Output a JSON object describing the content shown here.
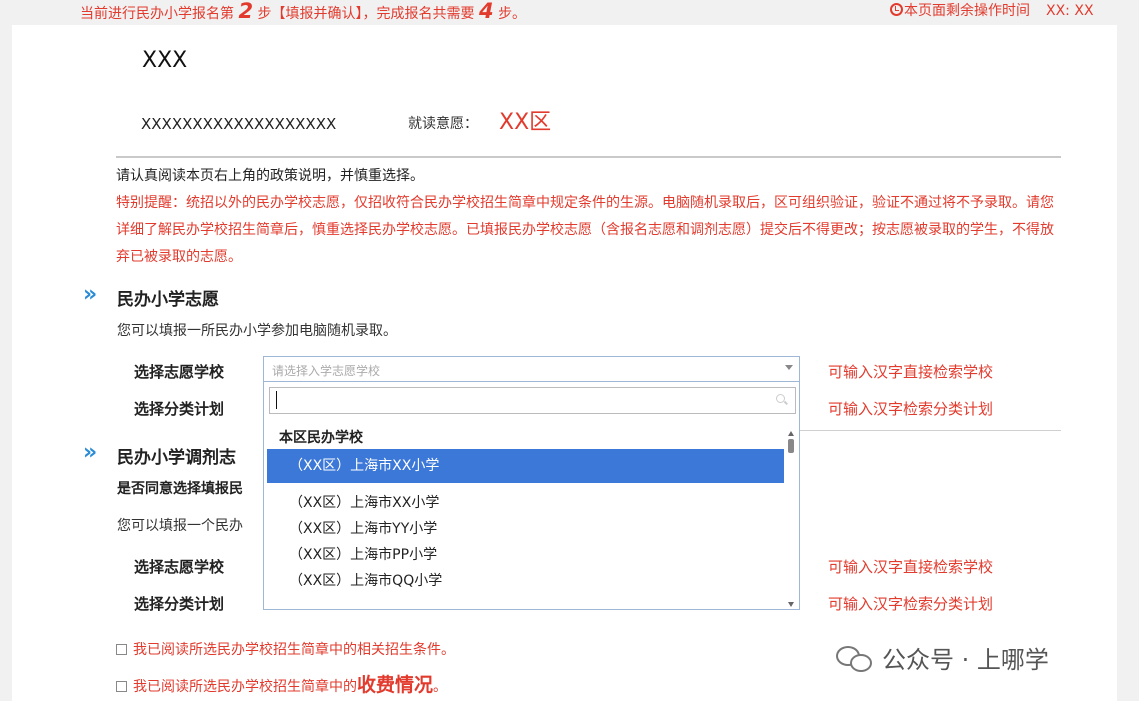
{
  "topbar": {
    "step_prefix": "当前进行民办小学报名第",
    "step_current": "2",
    "step_middle": "步【填报并确认】，完成报名共需要",
    "step_total": "4",
    "step_suffix": "步。",
    "timer_label": "本页面剩余操作时间",
    "timer_value": "XX: XX"
  },
  "student": {
    "name": "XXX",
    "id_number": "XXXXXXXXXXXXXXXXXXX",
    "intent_label": "就读意愿：",
    "intent_value": "XX区"
  },
  "notice": "请认真阅读本页右上角的政策说明，并慎重选择。",
  "warning": "特别提醒：统招以外的民办学校志愿，仅招收符合民办学校招生简章中规定条件的生源。电脑随机录取后，区可组织验证，验证不通过将不予录取。请您详细了解民办学校招生简章后，慎重选择民办学校志愿。已填报民办学校志愿（含报名志愿和调剂志愿）提交后不得更改；按志愿被录取的学生，不得放弃已被录取的志愿。",
  "section1": {
    "title": "民办小学志愿",
    "desc": "您可以填报一所民办小学参加电脑随机录取。",
    "school_label": "选择志愿学校",
    "plan_label": "选择分类计划",
    "school_hint": "可输入汉字直接检索学校",
    "plan_hint": "可输入汉字检索分类计划",
    "school_placeholder": "请选择入学志愿学校"
  },
  "section2": {
    "title": "民办小学调剂志",
    "question": "是否同意选择填报民",
    "desc": "您可以填报一个民办",
    "school_label": "选择志愿学校",
    "plan_label": "选择分类计划",
    "school_hint": "可输入汉字直接检索学校",
    "plan_hint": "可输入汉字检索分类计划"
  },
  "dropdown": {
    "search_value": "",
    "group_label": "本区民办学校",
    "options": [
      "（XX区）上海市XX小学",
      "（XX区）上海市XX小学",
      "（XX区）上海市YY小学",
      "（XX区）上海市PP小学",
      "（XX区）上海市QQ小学"
    ],
    "selected_index": 0
  },
  "checks": {
    "item1": "我已阅读所选民办学校招生简章中的相关招生条件。",
    "item2_prefix": "我已阅读所选民办学校招生简章中的",
    "item2_emphasis": "收费情况",
    "item2_suffix": "。"
  },
  "watermark": {
    "text": "公众号 · 上哪学",
    "icon": "wechat-icon"
  },
  "colors": {
    "accent_red": "#e23b2e",
    "selection_blue": "#3c78d8",
    "chevron_blue": "#2a8bd6"
  }
}
